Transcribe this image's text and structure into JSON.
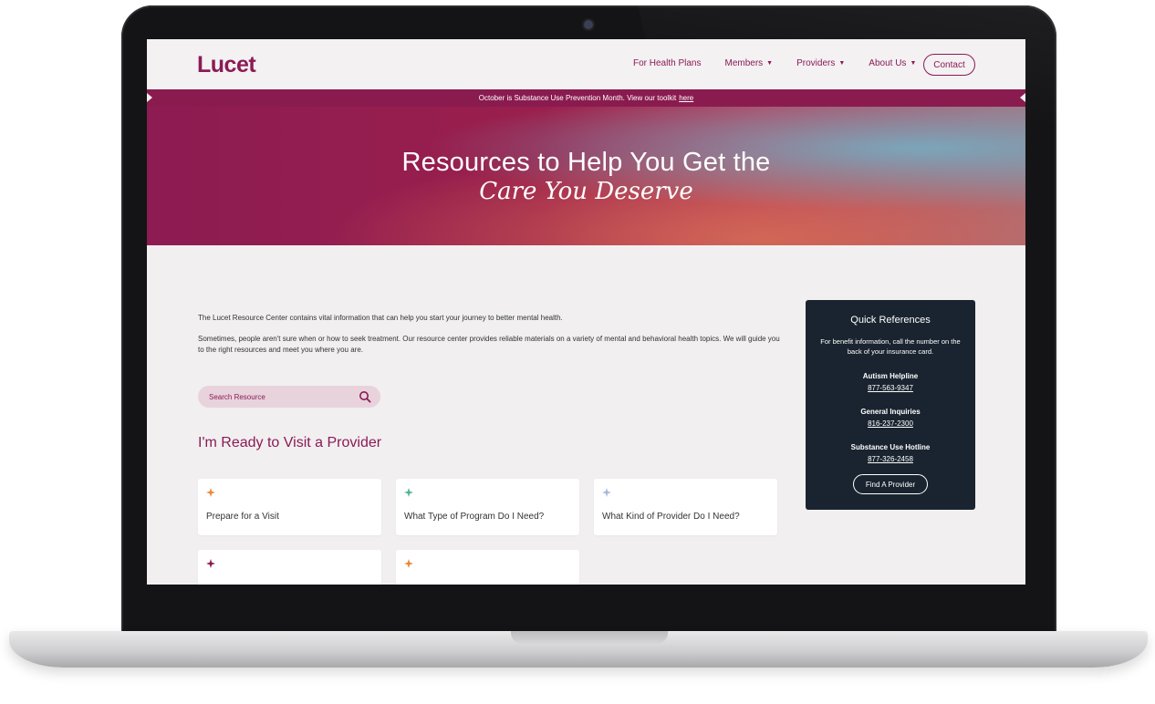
{
  "brand": {
    "logo": "Lucet",
    "accent": "#8a1b55",
    "dark_panel": "#1a2430"
  },
  "nav": {
    "items": [
      {
        "label": "For Health Plans",
        "has_caret": false
      },
      {
        "label": "Members",
        "has_caret": true
      },
      {
        "label": "Providers",
        "has_caret": true
      },
      {
        "label": "About Us",
        "has_caret": true
      }
    ],
    "caret_glyph": "▼",
    "contact_label": "Contact"
  },
  "banner": {
    "text": "October is Substance Use Prevention Month. View our toolkit",
    "link_text": "here"
  },
  "hero": {
    "line1": "Resources to Help You Get the",
    "line2": "Care You Deserve"
  },
  "intro": {
    "paragraph1": "The Lucet Resource Center contains vital information that can help you start your journey to better mental health.",
    "paragraph2": "Sometimes, people aren't sure when or how to seek treatment. Our resource center provides reliable materials on a variety of mental and behavioral health topics. We will guide you to the right resources and meet you where you are."
  },
  "search": {
    "placeholder": "Search Resource"
  },
  "section": {
    "heading": "I'm Ready to Visit a Provider"
  },
  "cards": [
    {
      "title": "Prepare for a Visit",
      "star_color": "#e8883a"
    },
    {
      "title": "What Type of Program Do I Need?",
      "star_color": "#4fb59a"
    },
    {
      "title": "What Kind of Provider Do I Need?",
      "star_color": "#a9b9dd"
    },
    {
      "title": "",
      "star_color": "#8a1b55"
    },
    {
      "title": "",
      "star_color": "#e8883a"
    }
  ],
  "quick_references": {
    "title": "Quick References",
    "description": "For benefit information, call the number on the back of your insurance card.",
    "contacts": [
      {
        "label": "Autism Helpline",
        "phone": "877-563-9347"
      },
      {
        "label": "General Inquiries",
        "phone": "816-237-2300"
      },
      {
        "label": "Substance Use Hotline",
        "phone": "877-326-2458"
      }
    ],
    "button_label": "Find A Provider"
  }
}
